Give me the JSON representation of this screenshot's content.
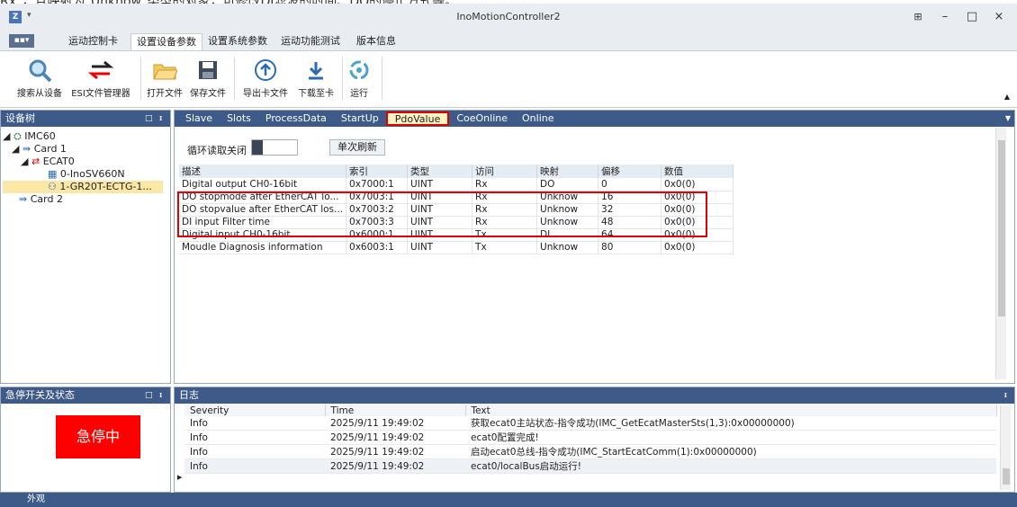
{
  "top_note": "Rx\"，且映射为\"Unknow\"类型的对象，可修改DI滤波的时间、DO的停止方式等。",
  "window": {
    "title": "InoMotionController2",
    "app_icon": "app-logo",
    "quick_access": "▾"
  },
  "ribbon_tabs": [
    "运动控制卡",
    "设置设备参数",
    "设置系统参数",
    "运动功能测试",
    "版本信息"
  ],
  "active_ribbon_tab": 1,
  "file_button": "▪▪▾",
  "ribbon_buttons": [
    {
      "label": "搜索从设备",
      "icon": "search-icon"
    },
    {
      "label": "ESI文件管理器",
      "icon": "swap-arrows-icon"
    },
    {
      "label": "打开文件",
      "icon": "folder-open-icon"
    },
    {
      "label": "保存文件",
      "icon": "save-disk-icon"
    },
    {
      "label": "导出卡文件",
      "icon": "upload-arrow-icon"
    },
    {
      "label": "下载至卡",
      "icon": "download-arrow-icon"
    },
    {
      "label": "运行",
      "icon": "run-cycle-icon"
    }
  ],
  "device_tree": {
    "title": "设备树",
    "nodes": [
      {
        "label": "IMC60"
      },
      {
        "label": "Card 1"
      },
      {
        "label": "ECAT0"
      },
      {
        "label": "0-InoSV660N"
      },
      {
        "label": "1-GR20T-ECTG-1..."
      },
      {
        "label": "Card 2"
      }
    ]
  },
  "estop_panel": {
    "title": "急停开关及状态",
    "button_label": "急停中",
    "button_color": "#ff0000"
  },
  "tabs": [
    "Slave",
    "Slots",
    "ProcessData",
    "StartUp",
    "PdoValue",
    "CoeOnline",
    "Online"
  ],
  "active_tab": 4,
  "cyclic_read_label": "循环读取关闭",
  "single_refresh_label": "单次刷新",
  "pdo_table": {
    "headers": [
      "描述",
      "索引",
      "类型",
      "访问",
      "映射",
      "偏移",
      "数值"
    ],
    "rows": [
      [
        "Digital output CH0-16bit",
        "0x7000:1",
        "UINT",
        "Rx",
        "DO",
        "0",
        "0x0(0)"
      ],
      [
        "DO stopmode after EtherCAT lo...",
        "0x7003:1",
        "UINT",
        "Rx",
        "Unknow",
        "16",
        "0x0(0)"
      ],
      [
        "DO stopvalue after EtherCAT los...",
        "0x7003:2",
        "UINT",
        "Rx",
        "Unknow",
        "32",
        "0x0(0)"
      ],
      [
        "DI input Filter time",
        "0x7003:3",
        "UINT",
        "Rx",
        "Unknow",
        "48",
        "0x0(0)"
      ],
      [
        "Digital input CH0-16bit",
        "0x6000:1",
        "UINT",
        "Tx",
        "DI",
        "64",
        "0x0(0)"
      ],
      [
        "Moudle Diagnosis information",
        "0x6003:1",
        "UINT",
        "Tx",
        "Unknow",
        "80",
        "0x0(0)"
      ]
    ]
  },
  "log": {
    "title": "日志",
    "headers": [
      "Severity",
      "Time",
      "Text"
    ],
    "rows": [
      [
        "Info",
        "2025/9/11 19:49:02",
        "获取ecat0主站状态-指令成功(IMC_GetEcatMasterSts(1,3):0x00000000)"
      ],
      [
        "Info",
        "2025/9/11 19:49:02",
        "ecat0配置完成!"
      ],
      [
        "Info",
        "2025/9/11 19:49:02",
        "启动ecat0总线-指令成功(IMC_StartEcatComm(1):0x00000000)"
      ],
      [
        "Info",
        "2025/9/11 19:49:02",
        "ecat0/localBus启动运行!"
      ]
    ]
  },
  "status_bar": "外观",
  "colors": {
    "panel_header": "#3d5a88",
    "highlight": "#e00000",
    "selected_tab": "#fff3c4"
  }
}
